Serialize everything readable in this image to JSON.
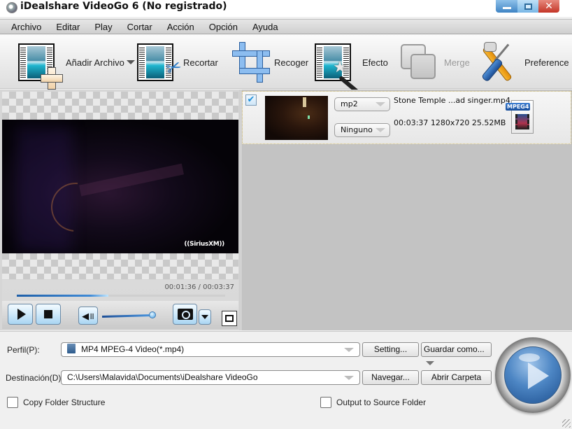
{
  "window": {
    "title": "iDealshare VideoGo 6 (No registrado)",
    "controls": {
      "minimize": "minimize",
      "maximize": "maximize",
      "close": "✕"
    }
  },
  "menu": [
    "Archivo",
    "Editar",
    "Play",
    "Cortar",
    "Acción",
    "Opción",
    "Ayuda"
  ],
  "toolbar": {
    "add_file": "Añadir Archivo",
    "trim": "Recortar",
    "crop": "Recoger",
    "effect": "Efecto",
    "merge": "Merge",
    "preference": "Preference"
  },
  "preview": {
    "watermark": "((SiriusXM))",
    "current_time": "00:01:36",
    "total_time": "00:03:37",
    "time_display": "00:01:36 / 00:03:37",
    "progress_fraction": 0.44,
    "volume_fraction": 0.95
  },
  "file_list": [
    {
      "checked": true,
      "audio_codec": "mp2",
      "subtitle": "Ninguno",
      "name": "Stone Temple ...ad singer.mp4",
      "duration": "00:03:37",
      "resolution": "1280x720",
      "size": "25.52MB",
      "meta": "00:03:37  1280x720 25.52MB",
      "format_badge": "MPEG4"
    }
  ],
  "output": {
    "profile_label": "Perfil(P):",
    "profile_value": "MP4 MPEG-4 Video(*.mp4)",
    "setting_button": "Setting...",
    "save_as_button": "Guardar como...",
    "destination_label": "Destinación(D):",
    "destination_value": "C:\\Users\\Malavida\\Documents\\iDealshare VideoGo",
    "browse_button": "Navegar...",
    "open_folder_button": "Abrir Carpeta",
    "copy_folder_structure": {
      "label": "Copy Folder Structure",
      "checked": false
    },
    "output_to_source": {
      "label": "Output to Source Folder",
      "checked": false
    }
  },
  "colors": {
    "accent_blue": "#3f84c4",
    "close_red": "#c43527",
    "list_bg": "#c3c3c3",
    "selected_row_border": "#c9b46a"
  }
}
